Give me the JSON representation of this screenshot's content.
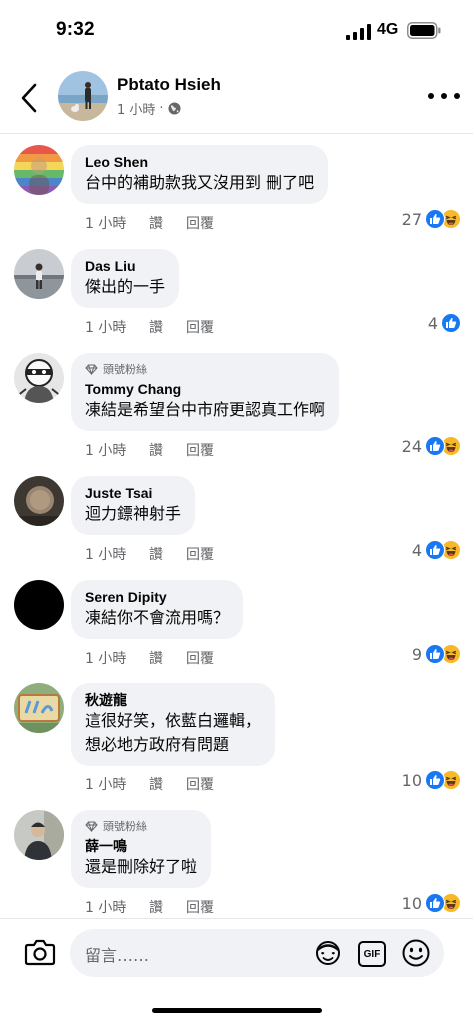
{
  "status_bar": {
    "time": "9:32",
    "network": "4G"
  },
  "header": {
    "name": "Pbtato Hsieh",
    "time": "1 小時",
    "separator": "·"
  },
  "actions": {
    "like": "讚",
    "reply": "回覆"
  },
  "composer": {
    "placeholder": "留言……",
    "gif_label": "GIF"
  },
  "comments": [
    {
      "author": "Leo  Shen",
      "text": [
        "台中的補助款我又沒用到 刪了吧"
      ],
      "time": "1 小時",
      "reaction_count": "27",
      "reactions": [
        "like",
        "haha"
      ],
      "badge": ""
    },
    {
      "author": "Das Liu",
      "text": [
        "傑出的一手"
      ],
      "time": "1 小時",
      "reaction_count": "4",
      "reactions": [
        "like"
      ],
      "badge": ""
    },
    {
      "author": "Tommy Chang",
      "text": [
        "凍結是希望台中市府更認真工作啊"
      ],
      "time": "1 小時",
      "reaction_count": "24",
      "reactions": [
        "like",
        "haha"
      ],
      "badge": "頭號粉絲"
    },
    {
      "author": "Juste Tsai",
      "text": [
        "迴力鏢神射手"
      ],
      "time": "1 小時",
      "reaction_count": "4",
      "reactions": [
        "like",
        "haha"
      ],
      "badge": ""
    },
    {
      "author": "Seren Dipity",
      "text": [
        "凍結你不會流用嗎？"
      ],
      "time": "1 小時",
      "reaction_count": "9",
      "reactions": [
        "like",
        "haha"
      ],
      "badge": ""
    },
    {
      "author": "秋遊龍",
      "text": [
        "這很好笑，依藍白邏輯，",
        "想必地方政府有問題"
      ],
      "time": "1 小時",
      "reaction_count": "10",
      "reactions": [
        "like",
        "haha"
      ],
      "badge": ""
    },
    {
      "author": "薛一鳴",
      "text": [
        "還是刪除好了啦"
      ],
      "time": "1 小時",
      "reaction_count": "10",
      "reactions": [
        "like",
        "haha"
      ],
      "badge": "頭號粉絲"
    }
  ]
}
